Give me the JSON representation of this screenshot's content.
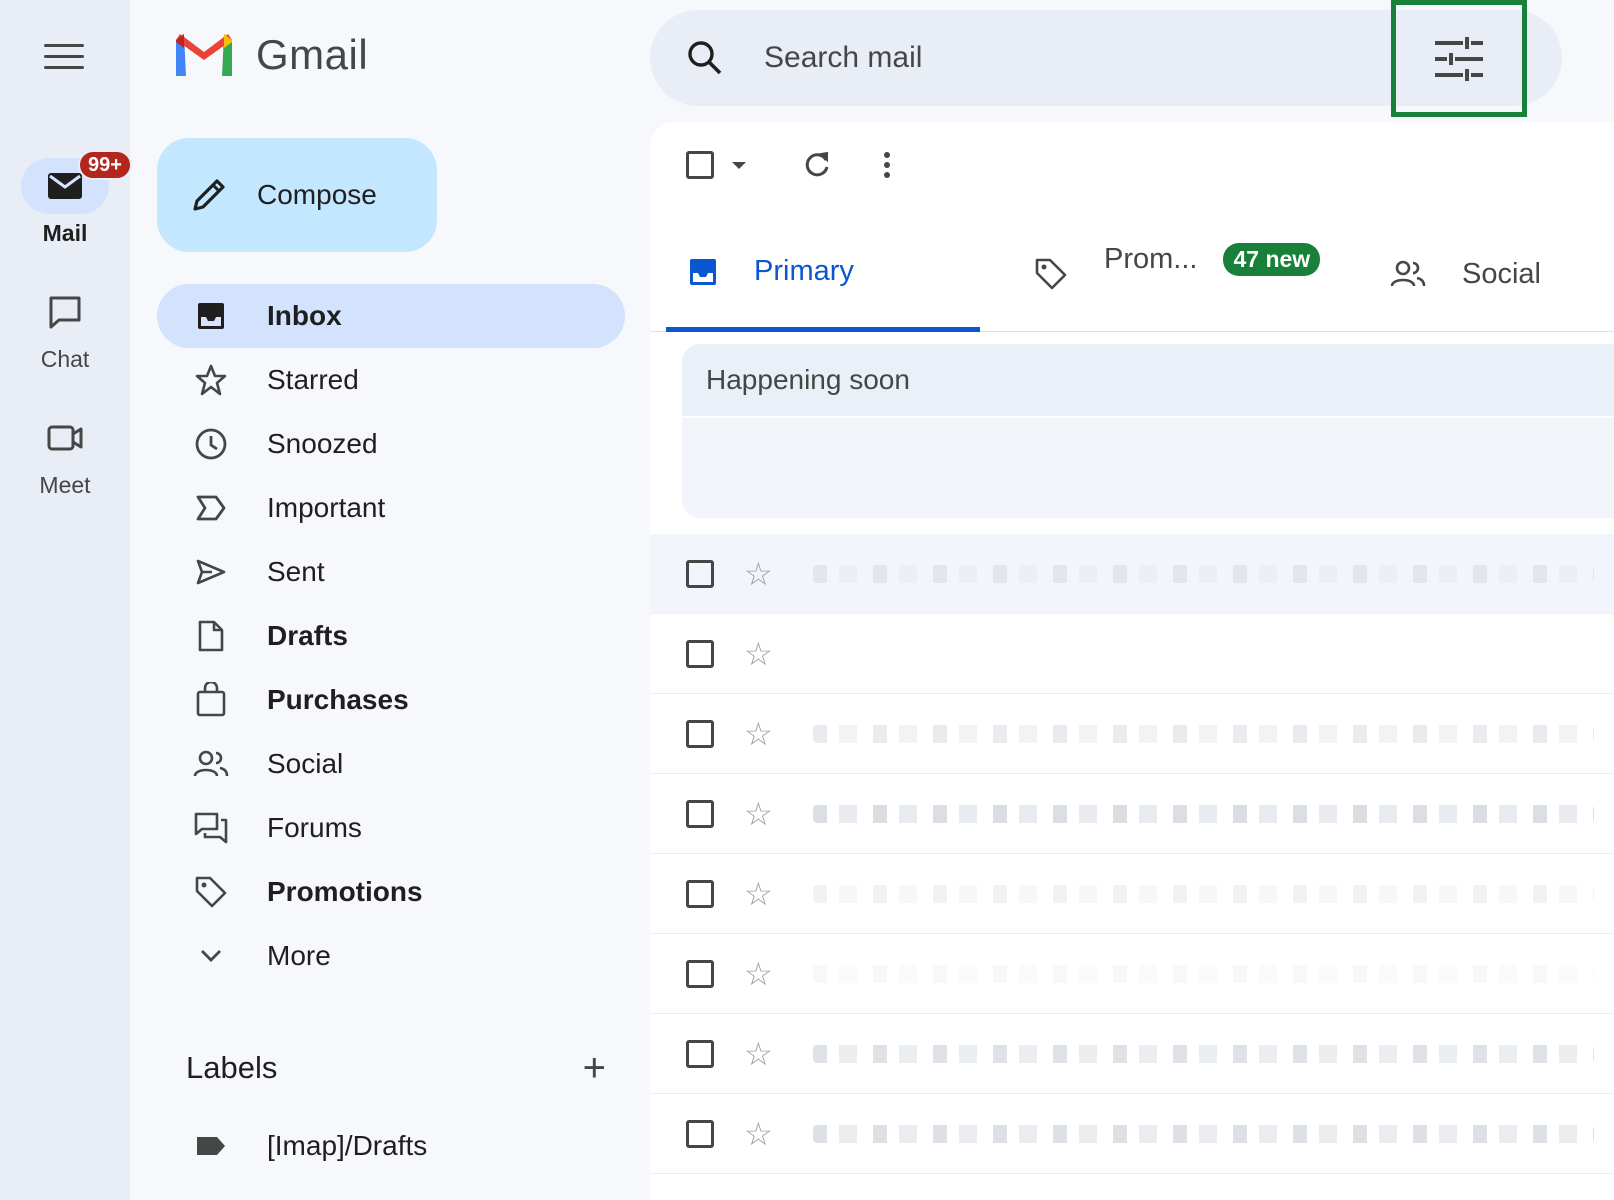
{
  "rail": {
    "items": [
      {
        "label": "Mail",
        "badge": "99+"
      },
      {
        "label": "Chat"
      },
      {
        "label": "Meet"
      }
    ]
  },
  "brand": {
    "name": "Gmail"
  },
  "compose": {
    "label": "Compose"
  },
  "nav": {
    "items": [
      {
        "label": "Inbox",
        "icon": "inbox-icon"
      },
      {
        "label": "Starred",
        "icon": "star-icon"
      },
      {
        "label": "Snoozed",
        "icon": "clock-icon"
      },
      {
        "label": "Important",
        "icon": "important-icon"
      },
      {
        "label": "Sent",
        "icon": "send-icon"
      },
      {
        "label": "Drafts",
        "icon": "draft-icon"
      },
      {
        "label": "Purchases",
        "icon": "shopping-bag-icon"
      },
      {
        "label": "Social",
        "icon": "people-icon"
      },
      {
        "label": "Forums",
        "icon": "forum-icon"
      },
      {
        "label": "Promotions",
        "icon": "tag-icon"
      },
      {
        "label": "More",
        "icon": "chevron-down-icon"
      }
    ]
  },
  "labels": {
    "title": "Labels",
    "items": [
      {
        "label": "[Imap]/Drafts"
      }
    ]
  },
  "search": {
    "placeholder": "Search mail"
  },
  "tabs": {
    "primary": {
      "label": "Primary"
    },
    "promotions": {
      "label": "Prom...",
      "badge": "47 new"
    },
    "social": {
      "label": "Social"
    }
  },
  "happening": {
    "title": "Happening soon"
  },
  "colors": {
    "accent": "#0b57d0",
    "compose": "#c2e7ff",
    "highlight": "#188038",
    "badge": "#b3261e"
  }
}
